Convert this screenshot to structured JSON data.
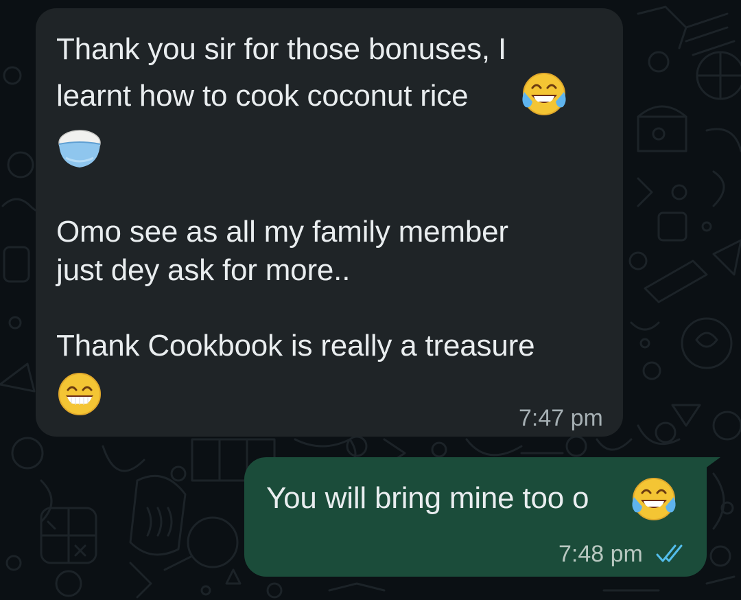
{
  "incoming_message": {
    "line1": "Thank you sir for those bonuses, I",
    "line2": "learnt how to cook coconut rice",
    "emoji_after_line2": "face-with-tears-of-joy",
    "emoji_line3": "cooked-rice",
    "line4": "Omo see as all my family member",
    "line5": "just dey ask for more..",
    "line6": "Thank Cookbook is really a treasure",
    "emoji_line7": "beaming-face-with-smiling-eyes",
    "timestamp": "7:47 pm"
  },
  "outgoing_message": {
    "text": "You will bring mine too o",
    "emoji": "face-with-tears-of-joy",
    "timestamp": "7:48 pm",
    "status_icon": "double-check-read-icon"
  },
  "colors": {
    "background": "#0b1014",
    "incoming_bubble": "#1f2427",
    "outgoing_bubble": "#1b4c3a",
    "message_text": "#e9edef",
    "timestamp_text": "#a6b0b4",
    "read_ticks": "#53bdeb"
  }
}
